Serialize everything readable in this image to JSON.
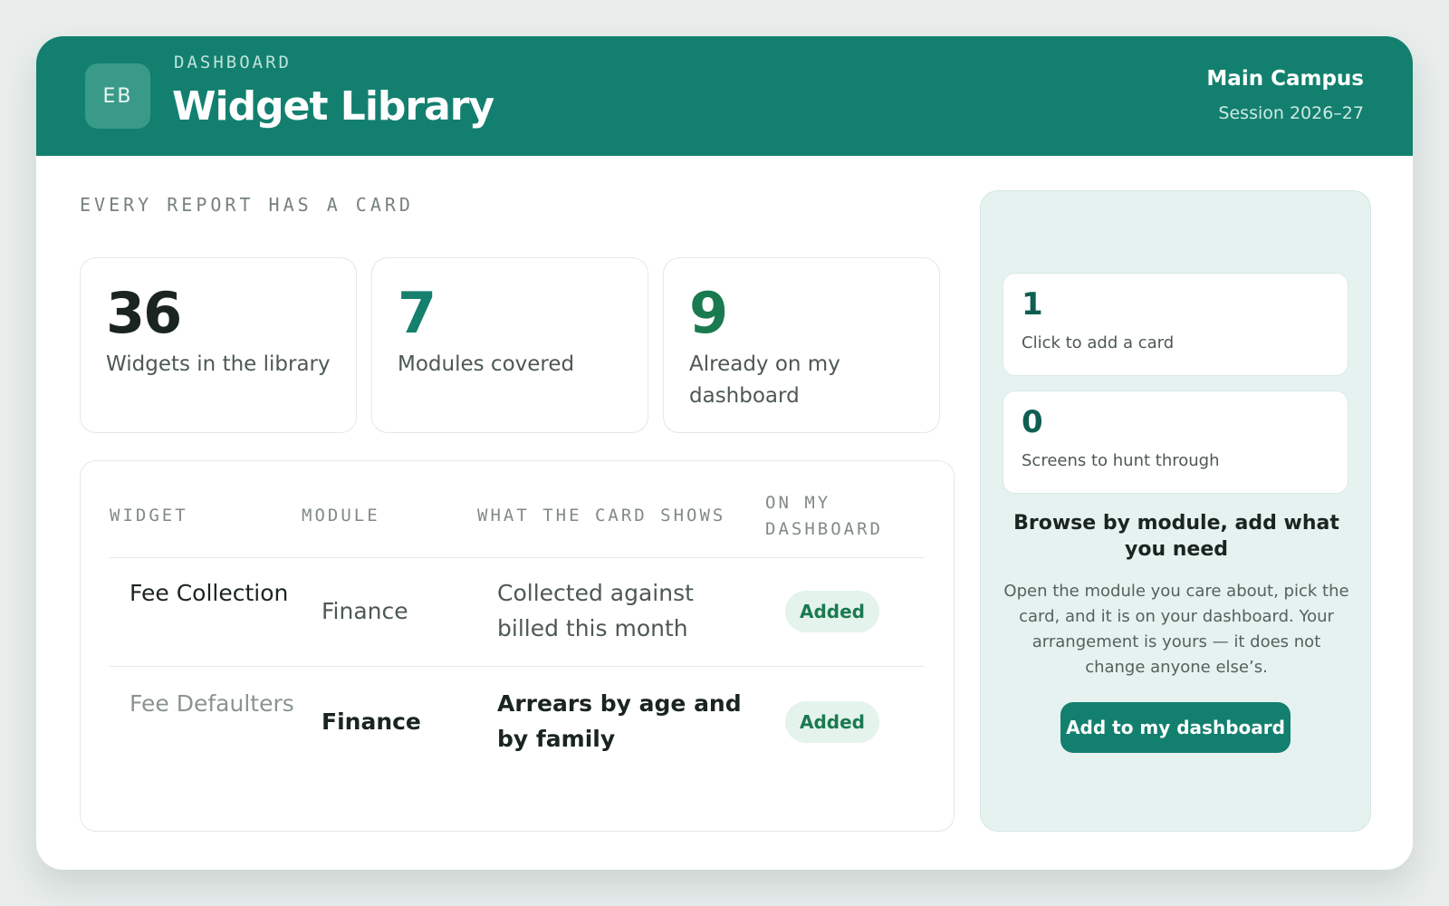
{
  "header": {
    "avatar_initials": "EB",
    "eyebrow": "DASHBOARD",
    "title": "Widget Library",
    "campus": "Main Campus",
    "session": "Session 2026–27"
  },
  "section_label": "EVERY REPORT HAS A CARD",
  "stats": [
    {
      "value": "36",
      "label": "Widgets in the library",
      "color": "#1a2421"
    },
    {
      "value": "7",
      "label": "Modules covered",
      "color": "#16806e"
    },
    {
      "value": "9",
      "label": "Already on my dashboard",
      "color": "#1a7a4f"
    }
  ],
  "table": {
    "headers": {
      "widget": "WIDGET",
      "module": "MODULE",
      "shows": "WHAT THE CARD SHOWS",
      "on_dashboard": "ON MY DASHBOARD"
    },
    "rows": [
      {
        "widget": "Fee Collection",
        "module": "Finance",
        "shows": "Collected against billed this month",
        "status": "Added"
      },
      {
        "widget": "Fee Defaulters",
        "module": "Finance",
        "shows": "Arrears by age and by family",
        "status": "Added"
      }
    ]
  },
  "side_panel": {
    "cards": [
      {
        "value": "1",
        "label": "Click to add a card"
      },
      {
        "value": "0",
        "label": "Screens to hunt through"
      }
    ],
    "heading": "Browse by module, add what you need",
    "description": "Open the module you care about, pick the card, and it is on your dashboard. Your arrangement is yours — it does not change anyone else’s.",
    "button_label": "Add to my dashboard"
  },
  "colors": {
    "brand": "#13806f",
    "badge_bg": "#e4f3ec",
    "badge_text": "#1a7a4f"
  }
}
